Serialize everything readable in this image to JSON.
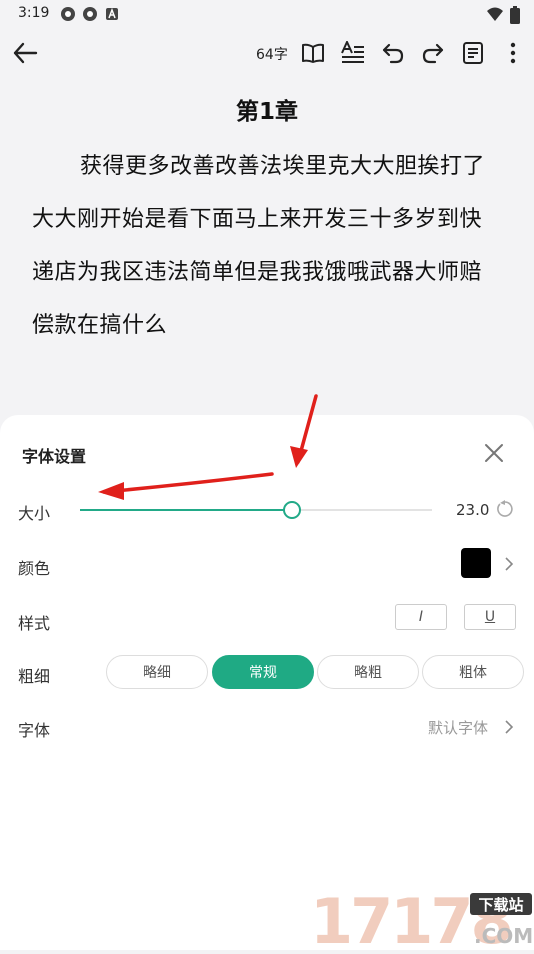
{
  "status": {
    "time": "3:19"
  },
  "toolbar": {
    "word_count": "64字"
  },
  "reader": {
    "chapter_title": "第1章",
    "text": "获得更多改善改善法埃里克大大胆挨打了大大刚开始是看下面马上来开发三十多岁到快递店为我区违法简单但是我我饿哦武器大师赔偿款在搞什么"
  },
  "font_settings": {
    "title": "字体设置",
    "size": {
      "label": "大小",
      "value": "23.0",
      "fraction": 0.6
    },
    "color": {
      "label": "颜色",
      "swatch": "#000000"
    },
    "style": {
      "label": "样式",
      "italic_glyph": "I",
      "underline_glyph": "U"
    },
    "weight": {
      "label": "粗细",
      "options": [
        "略细",
        "常规",
        "略粗",
        "粗体"
      ],
      "selected_index": 1
    },
    "font": {
      "label": "字体",
      "value": "默认字体"
    }
  },
  "colors": {
    "accent": "#1faa84",
    "annotation": "#e0201b"
  },
  "watermark": {
    "number": "17178",
    "site": "下载站",
    "suffix": ".COM"
  }
}
